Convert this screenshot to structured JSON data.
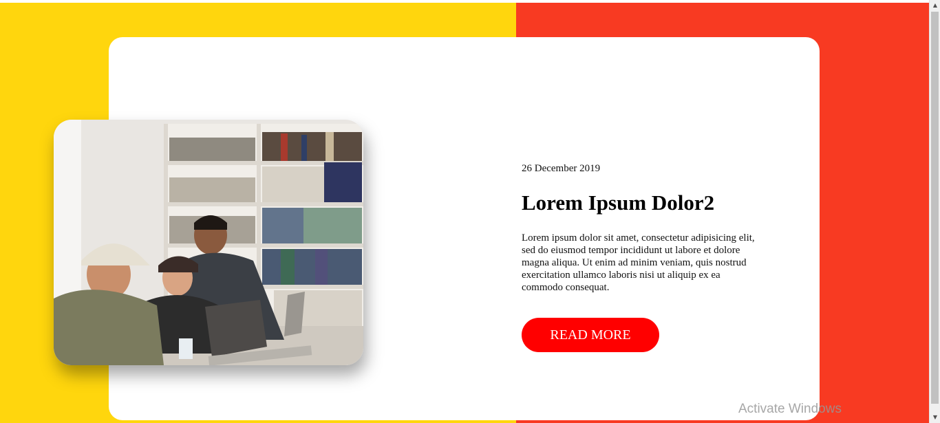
{
  "post": {
    "date": "26 December 2019",
    "title": "Lorem Ipsum Dolor2",
    "body": "Lorem ipsum dolor sit amet, consectetur adipisicing elit, sed do eiusmod tempor incididunt ut labore et dolore magna aliqua. Ut enim ad minim veniam, quis nostrud exercitation ullamco laboris nisi ut aliquip ex ea commodo consequat.",
    "button_label": "READ MORE"
  },
  "image": {
    "icon": "photo-students-library"
  },
  "colors": {
    "left_background": "#FFD60D",
    "right_background": "#F83A22",
    "button": "#FF0000",
    "card": "#FFFFFF"
  },
  "system": {
    "watermark": "Activate Windows",
    "scroll_up_icon": "▲",
    "scroll_down_icon": "▼"
  }
}
